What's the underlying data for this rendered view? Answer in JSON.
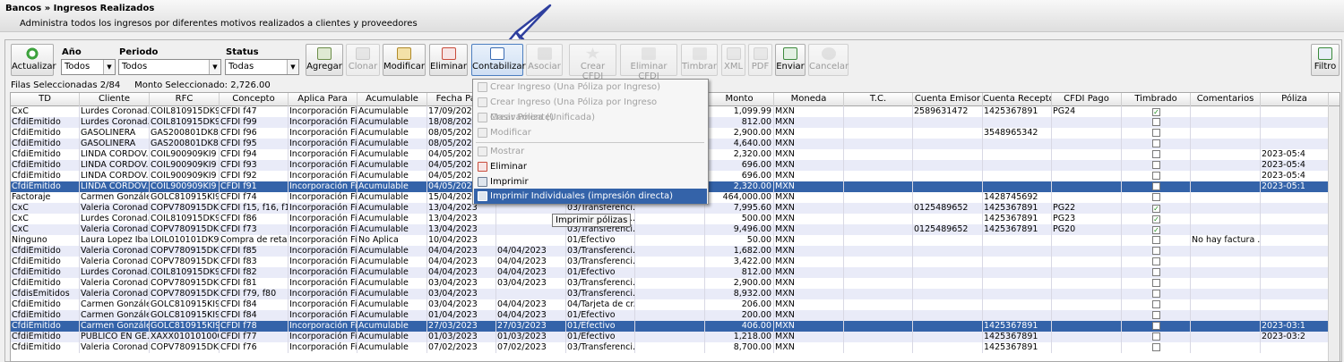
{
  "header": {
    "breadcrumb": "Bancos » Ingresos Realizados",
    "subtitle": "Administra todos los ingresos por diferentes motivos realizados a clientes y proveedores"
  },
  "toolbar": {
    "actualizar": "Actualizar",
    "agregar": "Agregar",
    "clonar": "Clonar",
    "modificar": "Modificar",
    "eliminar": "Eliminar",
    "contabilizar": "Contabilizar",
    "asociar": "Asociar",
    "crear_cfdi": "Crear CFDI",
    "eliminar_cfdi": "Eliminar CFDI",
    "timbrar": "Timbrar",
    "xml": "XML",
    "pdf": "PDF",
    "enviar": "Enviar",
    "cancelar": "Cancelar",
    "filtro": "Filtro"
  },
  "filters": {
    "anio_label": "Año",
    "anio_value": "Todos",
    "periodo_label": "Periodo",
    "periodo_value": "Todos",
    "status_label": "Status",
    "status_value": "Todas"
  },
  "info": {
    "filas": "Filas Seleccionadas  2/84",
    "monto": "Monto Seleccionado:  2,726.00"
  },
  "columns": [
    "TD",
    "Cliente",
    "RFC",
    "Concepto",
    "Aplica Para",
    "Acumulable",
    "Fecha Pago",
    "",
    "",
    "",
    "Monto",
    "Moneda",
    "T.C.",
    "Cuenta Emisor",
    "Cuenta Receptor",
    "CFDI Pago",
    "Timbrado",
    "Comentarios",
    "Póliza"
  ],
  "rows": [
    [
      "CxC",
      "Lurdes Coronad...",
      "COIL810915DK9",
      "CFDI f47",
      "Incorporación Fi...",
      "Acumulable",
      "17/09/2023",
      "",
      "",
      "",
      "1,099.99",
      "MXN",
      "",
      "2589631472",
      "1425367891",
      "PG24",
      "x",
      "",
      ""
    ],
    [
      "CfdiEmitido",
      "Lurdes Coronad...",
      "COIL810915DK9",
      "CFDI f99",
      "Incorporación Fi...",
      "Acumulable",
      "18/08/2023",
      "",
      "",
      "",
      "812.00",
      "MXN",
      "",
      "",
      "",
      "",
      "",
      "",
      ""
    ],
    [
      "CfdiEmitido",
      "GASOLINERA",
      "GAS200801DK8",
      "CFDI f96",
      "Incorporación Fi...",
      "Acumulable",
      "08/05/2023",
      "",
      "",
      "",
      "2,900.00",
      "MXN",
      "",
      "",
      "3548965342",
      "",
      "",
      "",
      ""
    ],
    [
      "CfdiEmitido",
      "GASOLINERA",
      "GAS200801DK8",
      "CFDI f95",
      "Incorporación Fi...",
      "Acumulable",
      "08/05/2023",
      "",
      "",
      "",
      "4,640.00",
      "MXN",
      "",
      "",
      "",
      "",
      "",
      "",
      ""
    ],
    [
      "CfdiEmitido",
      "LINDA CORDOV...",
      "COIL900909KI9",
      "CFDI f94",
      "Incorporación Fi...",
      "Acumulable",
      "04/05/2023",
      "",
      "",
      "",
      "2,320.00",
      "MXN",
      "",
      "",
      "",
      "",
      "",
      "",
      "2023-05:4"
    ],
    [
      "CfdiEmitido",
      "LINDA CORDOV...",
      "COIL900909KI9",
      "CFDI f93",
      "Incorporación Fi...",
      "Acumulable",
      "04/05/2023",
      "",
      "",
      "",
      "696.00",
      "MXN",
      "",
      "",
      "",
      "",
      "",
      "",
      "2023-05:4"
    ],
    [
      "CfdiEmitido",
      "LINDA CORDOV...",
      "COIL900909KI9",
      "CFDI f92",
      "Incorporación Fi...",
      "Acumulable",
      "04/05/2023",
      "",
      "",
      "",
      "696.00",
      "MXN",
      "",
      "",
      "",
      "",
      "",
      "",
      "2023-05:4"
    ],
    [
      "CfdiEmitido",
      "LINDA CORDOV...",
      "COIL900909KI9",
      "CFDI f91",
      "Incorporación Fi...",
      "Acumulable",
      "04/05/2023",
      "",
      "",
      "",
      "2,320.00",
      "MXN",
      "",
      "",
      "",
      "",
      "",
      "",
      "2023-05:1"
    ],
    [
      "Factoraje",
      "Carmen Gonzále...",
      "GOLC810915KI9",
      "CFDI f74",
      "Incorporación Fi...",
      "Acumulable",
      "15/04/2023",
      "",
      "",
      "",
      "464,000.00",
      "MXN",
      "",
      "",
      "1428745692",
      "",
      "",
      "",
      ""
    ],
    [
      "CxC",
      "Valeria Coronad...",
      "COPV780915DK9",
      "CFDI f15, f16, f1...",
      "Incorporación Fi...",
      "Acumulable",
      "13/04/2023",
      "",
      "03/Transferenci...",
      "",
      "7,995.60",
      "MXN",
      "",
      "0125489652",
      "1425367891",
      "PG22",
      "x",
      "",
      ""
    ],
    [
      "CxC",
      "Lurdes Coronad...",
      "COIL810915DK9",
      "CFDI f86",
      "Incorporación Fi...",
      "Acumulable",
      "13/04/2023",
      "",
      "03/Transfer...cr...",
      "",
      "500.00",
      "MXN",
      "",
      "",
      "1425367891",
      "PG23",
      "x",
      "",
      ""
    ],
    [
      "CxC",
      "Valeria Coronad...",
      "COPV780915DK9",
      "CFDI f73",
      "Incorporación Fi...",
      "Acumulable",
      "13/04/2023",
      "",
      "03/Transferenci...",
      "",
      "9,496.00",
      "MXN",
      "",
      "0125489652",
      "1425367891",
      "PG20",
      "x",
      "",
      ""
    ],
    [
      "Ninguno",
      "Laura Lopez Ibarra",
      "LOIL010101DK9",
      "Compra de retaz...",
      "Incorporación Fi...",
      "No Aplica",
      "10/04/2023",
      "",
      "01/Efectivo",
      "",
      "50.00",
      "MXN",
      "",
      "",
      "",
      "",
      "",
      "No hay factura ...",
      ""
    ],
    [
      "CfdiEmitido",
      "Valeria Coronad...",
      "COPV780915DK9",
      "CFDI f85",
      "Incorporación Fi...",
      "Acumulable",
      "04/04/2023",
      "04/04/2023",
      "03/Transferenci...",
      "",
      "1,682.00",
      "MXN",
      "",
      "",
      "",
      "",
      "",
      "",
      ""
    ],
    [
      "CfdiEmitido",
      "Valeria Coronad...",
      "COPV780915DK9",
      "CFDI f83",
      "Incorporación Fi...",
      "Acumulable",
      "04/04/2023",
      "04/04/2023",
      "03/Transferenci...",
      "",
      "3,422.00",
      "MXN",
      "",
      "",
      "",
      "",
      "",
      "",
      ""
    ],
    [
      "CfdiEmitido",
      "Lurdes Coronad...",
      "COIL810915DK9",
      "CFDI f82",
      "Incorporación Fi...",
      "Acumulable",
      "04/04/2023",
      "04/04/2023",
      "01/Efectivo",
      "",
      "812.00",
      "MXN",
      "",
      "",
      "",
      "",
      "",
      "",
      ""
    ],
    [
      "CfdiEmitido",
      "Valeria Coronad...",
      "COPV780915DK9",
      "CFDI f81",
      "Incorporación Fi...",
      "Acumulable",
      "03/04/2023",
      "03/04/2023",
      "03/Transferenci...",
      "",
      "2,900.00",
      "MXN",
      "",
      "",
      "",
      "",
      "",
      "",
      ""
    ],
    [
      "CfdisEmitidos",
      "Valeria Coronad...",
      "COPV780915DK9",
      "CFDI f79, f80",
      "Incorporación Fi...",
      "Acumulable",
      "03/04/2023",
      "",
      "03/Transferenci...",
      "",
      "8,932.00",
      "MXN",
      "",
      "",
      "",
      "",
      "",
      "",
      ""
    ],
    [
      "CfdiEmitido",
      "Carmen Gonzále...",
      "GOLC810915KI9",
      "CFDI f84",
      "Incorporación Fi...",
      "Acumulable",
      "03/04/2023",
      "04/04/2023",
      "04/Tarjeta de cr...",
      "",
      "206.00",
      "MXN",
      "",
      "",
      "",
      "",
      "",
      "",
      ""
    ],
    [
      "CfdiEmitido",
      "Carmen Gonzále...",
      "GOLC810915KI9",
      "CFDI f84",
      "Incorporación Fi...",
      "Acumulable",
      "01/04/2023",
      "04/04/2023",
      "01/Efectivo",
      "",
      "200.00",
      "MXN",
      "",
      "",
      "",
      "",
      "",
      "",
      ""
    ],
    [
      "CfdiEmitido",
      "Carmen Gonzále...",
      "GOLC810915KI9",
      "CFDI f78",
      "Incorporación Fi...",
      "Acumulable",
      "27/03/2023",
      "27/03/2023",
      "01/Efectivo",
      "",
      "406.00",
      "MXN",
      "",
      "",
      "1425367891",
      "",
      "",
      "",
      "2023-03:1"
    ],
    [
      "CfdiEmitido",
      "PUBLICO EN GE...",
      "XAXX010101000",
      "CFDI f77",
      "Incorporación Fi...",
      "Acumulable",
      "01/03/2023",
      "01/03/2023",
      "01/Efectivo",
      "",
      "1,218.00",
      "MXN",
      "",
      "",
      "1425367891",
      "",
      "",
      "",
      "2023-03:2"
    ],
    [
      "CfdiEmitido",
      "Valeria Coronad...",
      "COPV780915DK9",
      "CFDI f76",
      "Incorporación Fi...",
      "Acumulable",
      "07/02/2023",
      "07/02/2023",
      "03/Transferenci...",
      "",
      "8,700.00",
      "MXN",
      "",
      "",
      "1425367891",
      "",
      "",
      "",
      ""
    ]
  ],
  "selected_rows": [
    7,
    20
  ],
  "context_menu": {
    "items": [
      {
        "label": "Crear Ingreso (Una Póliza por Ingreso)",
        "enabled": false
      },
      {
        "label": "Crear Ingreso (Una Póliza por Ingreso Masivamente)",
        "enabled": false
      },
      {
        "label": "Crear Póliza (Unificada)",
        "enabled": false
      },
      {
        "label": "Modificar",
        "enabled": false
      },
      {
        "label": "Mostrar",
        "enabled": false
      },
      {
        "label": "Eliminar",
        "enabled": true
      },
      {
        "label": "Imprimir",
        "enabled": true
      },
      {
        "label": "Imprimir Individuales (impresión directa)",
        "enabled": true,
        "highlighted": true
      }
    ]
  },
  "tooltip": "Imprimir pólizas",
  "colors": {
    "selection": "#3463a9",
    "alt_row": "#e9ebf8"
  }
}
